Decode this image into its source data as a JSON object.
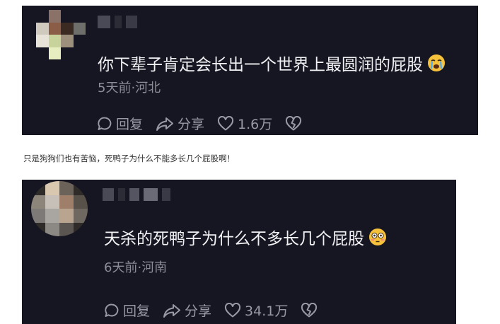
{
  "comment1": {
    "text": "你下辈子肯定会长出一个世界上最圆润的屁股",
    "emoji": "crying-face",
    "meta": "5天前·河北",
    "reply_label": "回复",
    "share_label": "分享",
    "like_count": "1.6万"
  },
  "caption": "只是狗狗们也有苦恼，死鸭子为什么不能多长几个屁股啊！",
  "comment2": {
    "text": "天杀的死鸭子为什么不多长几个屁股",
    "emoji": "flushed-face",
    "meta": "6天前·河南",
    "reply_label": "回复",
    "share_label": "分享",
    "like_count": "34.1万"
  },
  "colors": {
    "card_bg": "#161622",
    "text": "#f1f1f4",
    "muted": "#8d8d98",
    "emoji": "#f7c23b"
  }
}
